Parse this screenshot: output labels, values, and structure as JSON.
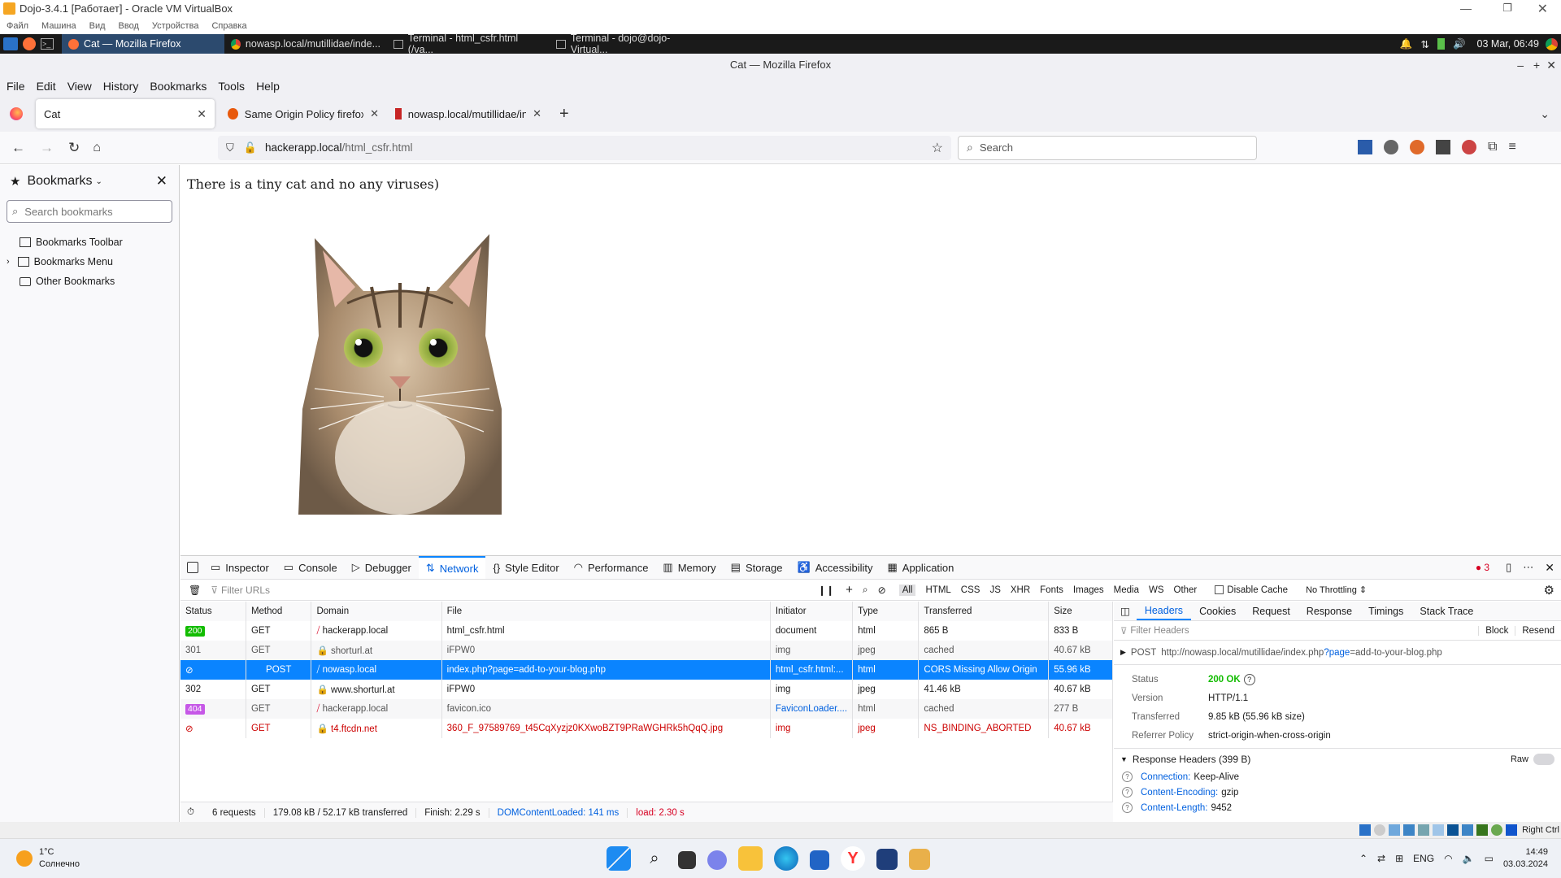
{
  "vbox": {
    "title": "Dojo-3.4.1 [Работает] - Oracle VM VirtualBox",
    "menu": [
      "Файл",
      "Машина",
      "Вид",
      "Ввод",
      "Устройства",
      "Справка"
    ]
  },
  "guest_taskbar": {
    "tasks": [
      "Cat — Mozilla Firefox",
      "nowasp.local/mutillidae/inde...",
      "Terminal - html_csfr.html (/va...",
      "Terminal - dojo@dojo-Virtual..."
    ],
    "clock": "03 Mar, 06:49"
  },
  "firefox": {
    "window_title": "Cat — Mozilla Firefox",
    "menu": [
      "File",
      "Edit",
      "View",
      "History",
      "Bookmarks",
      "Tools",
      "Help"
    ],
    "tabs": [
      {
        "label": "Cat"
      },
      {
        "label": "Same Origin Policy firefox at t"
      },
      {
        "label": "nowasp.local/mutillidae/index"
      }
    ],
    "url_host": "hackerapp.local",
    "url_path": "/html_csfr.html",
    "search_placeholder": "Search"
  },
  "sidebar": {
    "title": "Bookmarks",
    "search_placeholder": "Search bookmarks",
    "items": [
      "Bookmarks Toolbar",
      "Bookmarks Menu",
      "Other Bookmarks"
    ]
  },
  "page": {
    "text": "There is a tiny cat and no any viruses)"
  },
  "devtools": {
    "tabs": [
      "Inspector",
      "Console",
      "Debugger",
      "Network",
      "Style Editor",
      "Performance",
      "Memory",
      "Storage",
      "Accessibility",
      "Application"
    ],
    "error_count": "3",
    "filter_placeholder": "Filter URLs",
    "type_filters": [
      "All",
      "HTML",
      "CSS",
      "JS",
      "XHR",
      "Fonts",
      "Images",
      "Media",
      "WS",
      "Other"
    ],
    "disable_cache": "Disable Cache",
    "throttling": "No Throttling",
    "columns": [
      "Status",
      "Method",
      "Domain",
      "File",
      "Initiator",
      "Type",
      "Transferred",
      "Size"
    ],
    "rows": [
      {
        "status": "200",
        "method": "GET",
        "domain": "hackerapp.local",
        "file": "html_csfr.html",
        "initiator": "document",
        "type": "html",
        "transferred": "865 B",
        "size": "833 B"
      },
      {
        "status": "301",
        "method": "GET",
        "domain": "shorturl.at",
        "file": "iFPW0",
        "initiator": "img",
        "type": "jpeg",
        "transferred": "cached",
        "size": "40.67 kB"
      },
      {
        "status": "",
        "method": "POST",
        "domain": "nowasp.local",
        "file": "index.php?page=add-to-your-blog.php",
        "initiator": "html_csfr.html:...",
        "type": "html",
        "transferred": "CORS Missing Allow Origin",
        "size": "55.96 kB"
      },
      {
        "status": "302",
        "method": "GET",
        "domain": "www.shorturl.at",
        "file": "iFPW0",
        "initiator": "img",
        "type": "jpeg",
        "transferred": "41.46 kB",
        "size": "40.67 kB"
      },
      {
        "status": "404",
        "method": "GET",
        "domain": "hackerapp.local",
        "file": "favicon.ico",
        "initiator": "FaviconLoader....",
        "type": "html",
        "transferred": "cached",
        "size": "277 B"
      },
      {
        "status": "",
        "method": "GET",
        "domain": "t4.ftcdn.net",
        "file": "360_F_97589769_t45CqXyzjz0KXwoBZT9PRaWGHRk5hQqQ.jpg",
        "initiator": "img",
        "type": "jpeg",
        "transferred": "NS_BINDING_ABORTED",
        "size": "40.67 kB"
      }
    ],
    "summary": {
      "requests": "6 requests",
      "transferred": "179.08 kB / 52.17 kB transferred",
      "finish": "Finish: 2.29 s",
      "dom": "DOMContentLoaded: 141 ms",
      "load": "load: 2.30 s"
    },
    "detail_tabs": [
      "Headers",
      "Cookies",
      "Request",
      "Response",
      "Timings",
      "Stack Trace"
    ],
    "filter_headers": "Filter Headers",
    "block": "Block",
    "resend": "Resend",
    "request_method": "POST",
    "request_url_base": "http://nowasp.local/mutillidae/index.php",
    "request_url_q": "?page",
    "request_url_eq": "=add-to-your-blog.php",
    "info": [
      {
        "k": "Status",
        "v": "200 OK"
      },
      {
        "k": "Version",
        "v": "HTTP/1.1"
      },
      {
        "k": "Transferred",
        "v": "9.85 kB (55.96 kB size)"
      },
      {
        "k": "Referrer Policy",
        "v": "strict-origin-when-cross-origin"
      }
    ],
    "response_headers_title": "Response Headers (399 B)",
    "raw": "Raw",
    "response_headers": [
      {
        "k": "Connection:",
        "v": "Keep-Alive"
      },
      {
        "k": "Content-Encoding:",
        "v": "gzip"
      },
      {
        "k": "Content-Length:",
        "v": "9452"
      }
    ]
  },
  "vb_status": {
    "host_key": "Right Ctrl"
  },
  "win_taskbar": {
    "temp": "1°C",
    "weather": "Солнечно",
    "lang": "ENG",
    "time": "14:49",
    "date": "03.03.2024"
  },
  "colors": {
    "accent": "#0a84ff",
    "ok": "#12bc00",
    "error": "#d70022",
    "purple": "#c658e7"
  }
}
